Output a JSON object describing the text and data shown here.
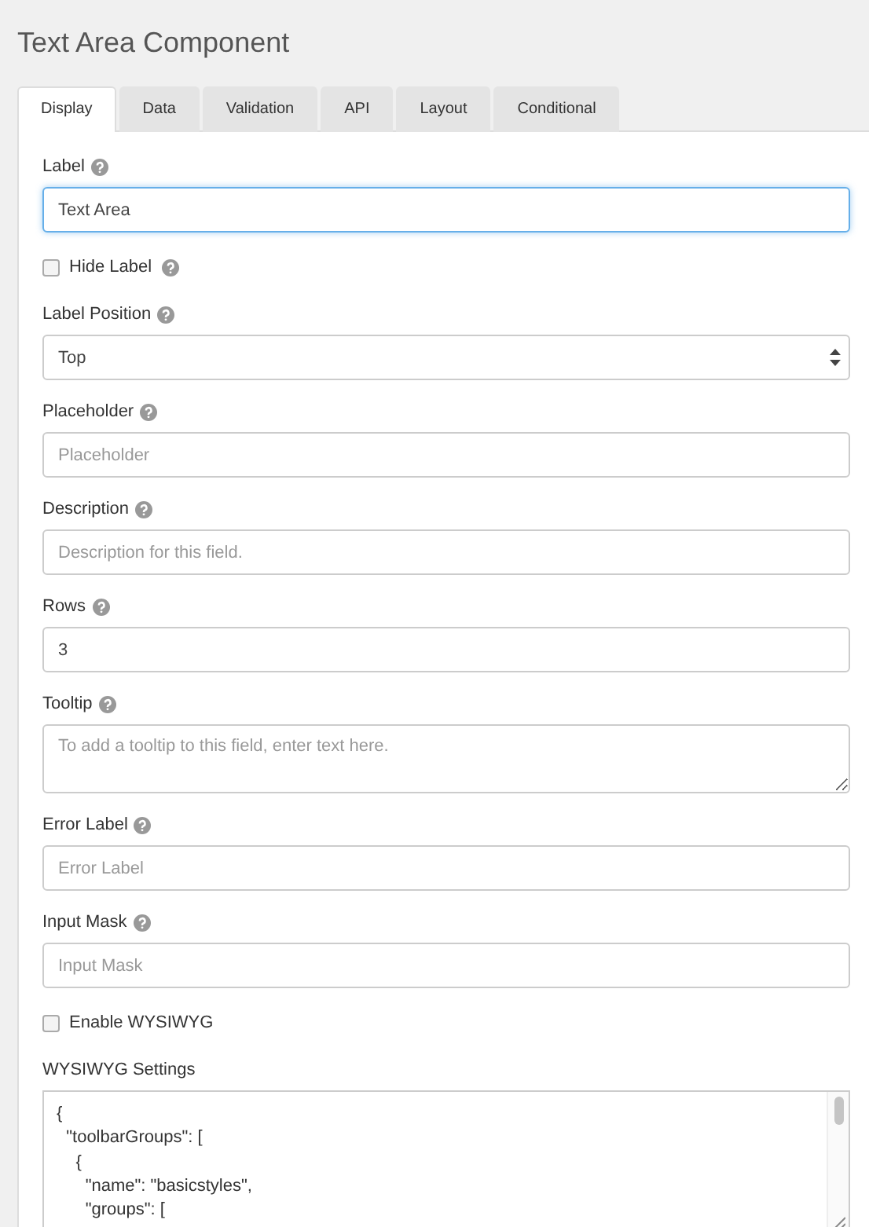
{
  "window": {
    "title": "Text Area Component"
  },
  "tabs": [
    {
      "label": "Display",
      "selected": true
    },
    {
      "label": "Data",
      "selected": false
    },
    {
      "label": "Validation",
      "selected": false
    },
    {
      "label": "API",
      "selected": false
    },
    {
      "label": "Layout",
      "selected": false
    },
    {
      "label": "Conditional",
      "selected": false
    }
  ],
  "fields": [
    {
      "kind": "text",
      "label": "Label",
      "help": true,
      "value": "Text Area",
      "focused": true
    },
    {
      "kind": "checkbox",
      "label": "Hide Label",
      "help": true,
      "checked": false
    },
    {
      "kind": "select",
      "label": "Label Position",
      "help": true,
      "value": "Top"
    },
    {
      "kind": "text",
      "label": "Placeholder",
      "help": true,
      "placeholder": "Placeholder",
      "focused": false
    },
    {
      "kind": "text",
      "label": "Description",
      "help": true,
      "placeholder": "Description for this field.",
      "focused": false
    },
    {
      "kind": "text",
      "label": "Rows",
      "help": true,
      "value": "3",
      "focused": false
    },
    {
      "kind": "textarea",
      "label": "Tooltip",
      "help": true,
      "placeholder": "To add a tooltip to this field, enter text here."
    },
    {
      "kind": "text",
      "label": "Error Label",
      "help": true,
      "placeholder": "Error Label",
      "focused": false
    },
    {
      "kind": "text",
      "label": "Input Mask",
      "help": true,
      "placeholder": "Input Mask",
      "focused": false
    },
    {
      "kind": "checkbox",
      "label": "Enable WYSIWYG",
      "help": false,
      "checked": false
    },
    {
      "kind": "code",
      "label": "WYSIWYG Settings",
      "help": false,
      "value": "{\n  \"toolbarGroups\": [\n    {\n      \"name\": \"basicstyles\",\n      \"groups\": ["
    }
  ]
}
